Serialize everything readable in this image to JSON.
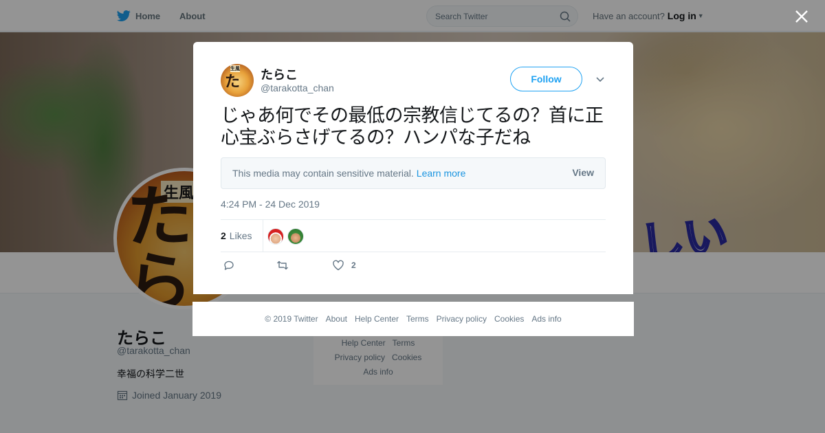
{
  "topbar": {
    "home_label": "Home",
    "about_label": "About",
    "search_placeholder": "Search Twitter",
    "account_prompt": "Have an account?",
    "login_label": "Log in"
  },
  "profile": {
    "name": "たらこ",
    "handle": "@tarakotta_chan",
    "bio": "幸福の科学二世",
    "joined": "Joined January 2019",
    "avatar_text": "たらこ",
    "avatar_subtext": "生風",
    "banner_text": "しい"
  },
  "bg_footer": {
    "row1": [
      "Help Center",
      "Terms"
    ],
    "row2": [
      "Privacy policy",
      "Cookies"
    ],
    "row3": [
      "Ads info"
    ]
  },
  "tweet": {
    "name": "たらこ",
    "handle": "@tarakotta_chan",
    "follow_label": "Follow",
    "text": "じゃあ何でその最低の宗教信じてるの？首に正心宝ぶらさげてるの？ハンパな子だね",
    "sensitive_text": "This media may contain sensitive material.",
    "learn_more": "Learn more",
    "view_label": "View",
    "timestamp": "4:24 PM - 24 Dec 2019",
    "likes_count": "2",
    "likes_label": "Likes",
    "like_action_count": "2"
  },
  "footer": {
    "copyright": "© 2019 Twitter",
    "about": "About",
    "help": "Help Center",
    "terms": "Terms",
    "privacy": "Privacy policy",
    "cookies": "Cookies",
    "ads": "Ads info"
  },
  "colors": {
    "brand": "#1da1f2",
    "link": "#1b95e0",
    "muted": "#657786"
  }
}
